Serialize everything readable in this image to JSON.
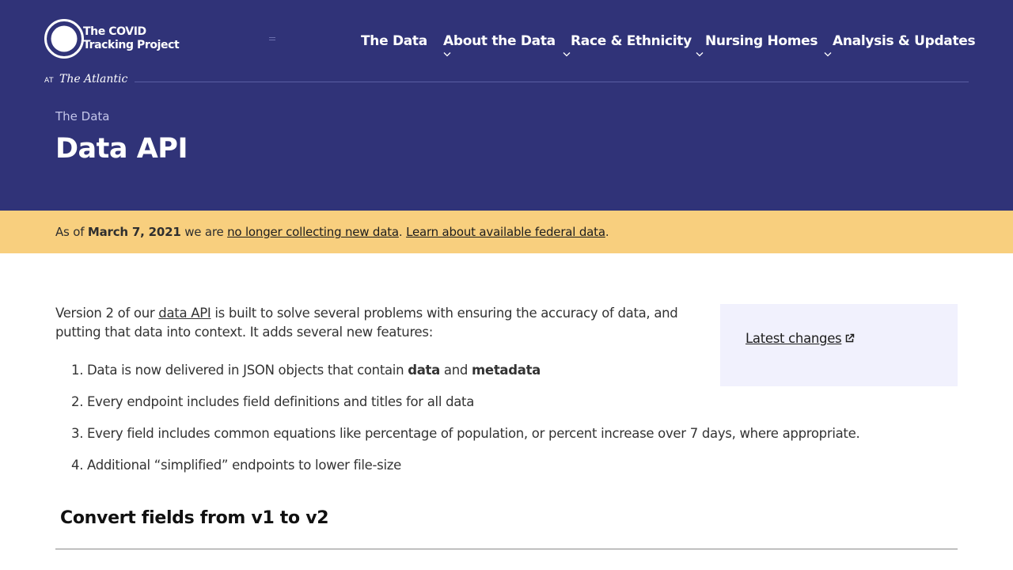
{
  "site": {
    "name_line1": "The COVID",
    "name_line2": "Tracking Project",
    "at_label": "AT",
    "partner": "The Atlantic"
  },
  "nav": {
    "items": [
      {
        "label": "The Data",
        "has_dropdown": false
      },
      {
        "label": "About the Data",
        "has_dropdown": true
      },
      {
        "label": "Race & Ethnicity",
        "has_dropdown": true
      },
      {
        "label": "Nursing Homes",
        "has_dropdown": true
      },
      {
        "label": "Analysis & Updates",
        "has_dropdown": true
      }
    ]
  },
  "header": {
    "breadcrumb": "The Data",
    "title": "Data API"
  },
  "banner": {
    "prefix": "As of ",
    "date": "March 7, 2021",
    "middle": " we are ",
    "link1": "no longer collecting new data",
    "sep": ". ",
    "link2": "Learn about available federal data",
    "suffix": "."
  },
  "intro": {
    "before_link": "Version 2 of our ",
    "link": "data API",
    "after_link": " is built to solve several problems with ensuring the accuracy of data, and putting that data into context. It adds several new features:"
  },
  "features": {
    "items": [
      {
        "num": "1.",
        "before": "Data is now delivered in JSON objects that contain ",
        "bold1": "data",
        "mid": " and ",
        "bold2": "metadata"
      },
      {
        "num": "2.",
        "text": "Every endpoint includes field definitions and titles for all data"
      },
      {
        "num": "3.",
        "text": "Every field includes common equations like percentage of population, or percent increase over 7 days, where appropriate."
      },
      {
        "num": "4.",
        "text": "Additional “simplified” endpoints to lower file-size"
      }
    ]
  },
  "sidebar": {
    "latest_changes": "Latest changes",
    "link_icon": "external-link-icon"
  },
  "section": {
    "title": "Convert fields from v1 to v2"
  },
  "colors": {
    "header_bg": "#303378",
    "banner_bg": "#f8cf7e",
    "sidebar_bg": "#f1f1fd"
  }
}
